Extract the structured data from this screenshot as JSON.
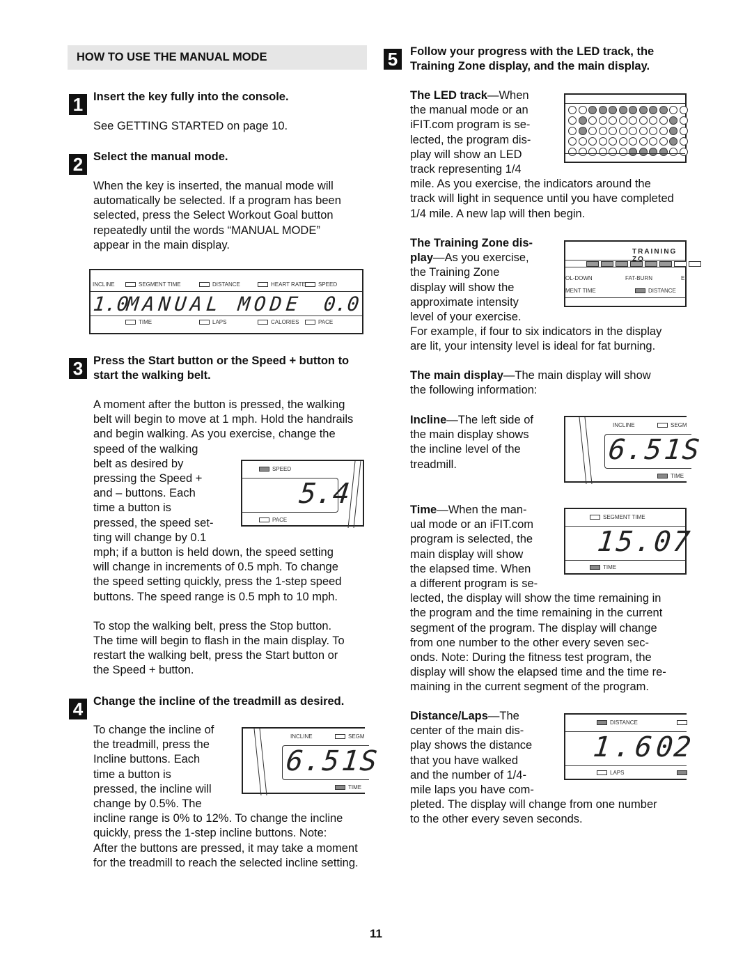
{
  "section_title": "HOW TO USE THE MANUAL MODE",
  "page_number": "11",
  "steps": [
    {
      "num": "1",
      "title": "Insert the key fully into the console.",
      "body": "See GETTING STARTED on page 10."
    },
    {
      "num": "2",
      "title": "Select the manual mode.",
      "body": [
        "When the key is inserted, the manual mode will",
        "automatically be selected. If a program has been",
        "selected, press the Select Workout Goal button",
        "repeatedly until the words “MANUAL MODE”",
        "appear in the main display."
      ]
    },
    {
      "num": "3",
      "title_lines": [
        "Press the Start button or the Speed + button to",
        "start the walking belt."
      ],
      "body_top": [
        "A moment after the button is pressed, the walking",
        "belt will begin to move at 1 mph. Hold the handrails",
        "and begin walking. As you exercise, change the"
      ],
      "body_wrap": [
        "speed of the walking",
        "belt as desired by",
        "pressing the Speed +",
        "and – buttons. Each",
        "time a button is",
        "pressed, the speed set-",
        "ting will change by 0.1"
      ],
      "body_bottom": [
        "mph; if a button is held down, the speed setting",
        "will change in increments of 0.5 mph. To change",
        "the speed setting quickly, press the 1-step speed",
        "buttons. The speed range is 0.5 mph to 10 mph."
      ],
      "body_stop": [
        "To stop the walking belt, press the Stop button.",
        "The time will begin to flash in the main display. To",
        "restart the walking belt, press the Start button or",
        "the Speed + button."
      ]
    },
    {
      "num": "4",
      "title": "Change the incline of the treadmill as desired.",
      "body_wrap": [
        "To change the incline of",
        "the treadmill, press the",
        "Incline buttons. Each",
        "time a button is",
        "pressed, the incline will",
        "change by 0.5%. The"
      ],
      "body_bottom": [
        "incline range is 0% to 12%. To change the incline",
        "quickly, press the 1-step incline buttons. Note:",
        "After the buttons are pressed, it may take a moment",
        "for the treadmill to reach the selected incline setting."
      ]
    },
    {
      "num": "5",
      "title_lines": [
        "Follow your progress with the LED track, the",
        "Training Zone display, and the main display."
      ]
    }
  ],
  "subsections": {
    "led_track": {
      "term": "The LED track",
      "wrap": [
        "—When",
        "the manual mode or an",
        "iFIT.com program is se-",
        "lected, the program dis-",
        "play will show an LED",
        "track representing 1/4"
      ],
      "after": [
        "mile. As you exercise, the indicators around the",
        "track will light in sequence until you have completed",
        "1/4 mile. A new lap will then begin."
      ]
    },
    "training_zone": {
      "term_1": "The Training Zone dis-",
      "term_2": "play",
      "wrap_first": "—As you exercise,",
      "wrap": [
        "the Training Zone",
        "display will show the",
        "approximate intensity",
        "level of your exercise."
      ],
      "after": [
        "For example, if four to six indicators in the display",
        "are lit, your intensity level is ideal for fat burning."
      ]
    },
    "main_display": {
      "term": "The main display",
      "rest": "—The main display will show",
      "line2": "the following information:"
    },
    "incline": {
      "term": "Incline",
      "wrap": [
        "—The left side of",
        "the main display shows",
        "the incline level of the",
        "treadmill."
      ]
    },
    "time": {
      "term": "Time",
      "wrap": [
        "—When the man-",
        "ual mode or an iFIT.com",
        "program is selected, the",
        "main display will show",
        "the elapsed time. When",
        "a different program is se-"
      ],
      "after": [
        "lected, the display will show the time remaining in",
        "the program and the time remaining in the current",
        "segment of the program. The display will change",
        "from one number to the other every seven sec-",
        "onds. Note: During the fitness test program, the",
        "display will show the elapsed time and the time re-",
        "maining in the current segment of the program."
      ]
    },
    "distance": {
      "term": "Distance/Laps",
      "wrap": [
        "—The",
        "center of the main dis-",
        "play shows the distance",
        "that you have walked",
        "and the number of 1/4-",
        "mile laps you have com-"
      ],
      "after": [
        "pleted. The display will change from one number",
        "to the other every seven seconds."
      ]
    }
  },
  "displays": {
    "manual_mode": {
      "top_labels": [
        "INCLINE",
        "SEGMENT TIME",
        "DISTANCE",
        "HEART RATE",
        "SPEED"
      ],
      "bottom_labels": [
        "TIME",
        "LAPS",
        "CALORIES",
        "PACE"
      ],
      "left_value": "1.0",
      "message": "MANUAL MODE",
      "right_value": "0.0"
    },
    "speed": {
      "top_label": "SPEED",
      "bottom_label": "PACE",
      "value": "5.4"
    },
    "incline_small": {
      "top_label": "INCLINE",
      "top_right_label": "SEGM",
      "bottom_label": "TIME",
      "value": "6.5",
      "partial": "1S"
    },
    "led_track": {
      "rows": [
        [
          0,
          0,
          1,
          1,
          1,
          1,
          1,
          1,
          1,
          1,
          0,
          0
        ],
        [
          0,
          1,
          0,
          0,
          0,
          0,
          0,
          0,
          0,
          0,
          1,
          0
        ],
        [
          0,
          1,
          0,
          0,
          0,
          0,
          0,
          0,
          0,
          0,
          1,
          0
        ],
        [
          0,
          0,
          0,
          0,
          0,
          0,
          0,
          0,
          0,
          0,
          1,
          0
        ],
        [
          0,
          0,
          0,
          0,
          0,
          0,
          1,
          1,
          1,
          1,
          0,
          0
        ]
      ]
    },
    "training_zone": {
      "title": "TRAINING ZO",
      "labels": [
        "OL-DOWN",
        "FAT-BURN",
        "EI"
      ],
      "bottom_labels": [
        "MENT TIME",
        "DISTANCE"
      ],
      "segments_lit": 6,
      "segments_total": 8
    },
    "incline_main": {
      "top_label": "INCLINE",
      "top_right_label": "SEGM",
      "bottom_label": "TIME",
      "value": "6.5",
      "partial": "1S"
    },
    "time": {
      "top_label": "SEGMENT TIME",
      "bottom_label": "TIME",
      "value": "15.07"
    },
    "distance": {
      "top_label": "DISTANCE",
      "bottom_label": "LAPS",
      "value": "1.60",
      "partial": "2"
    }
  }
}
